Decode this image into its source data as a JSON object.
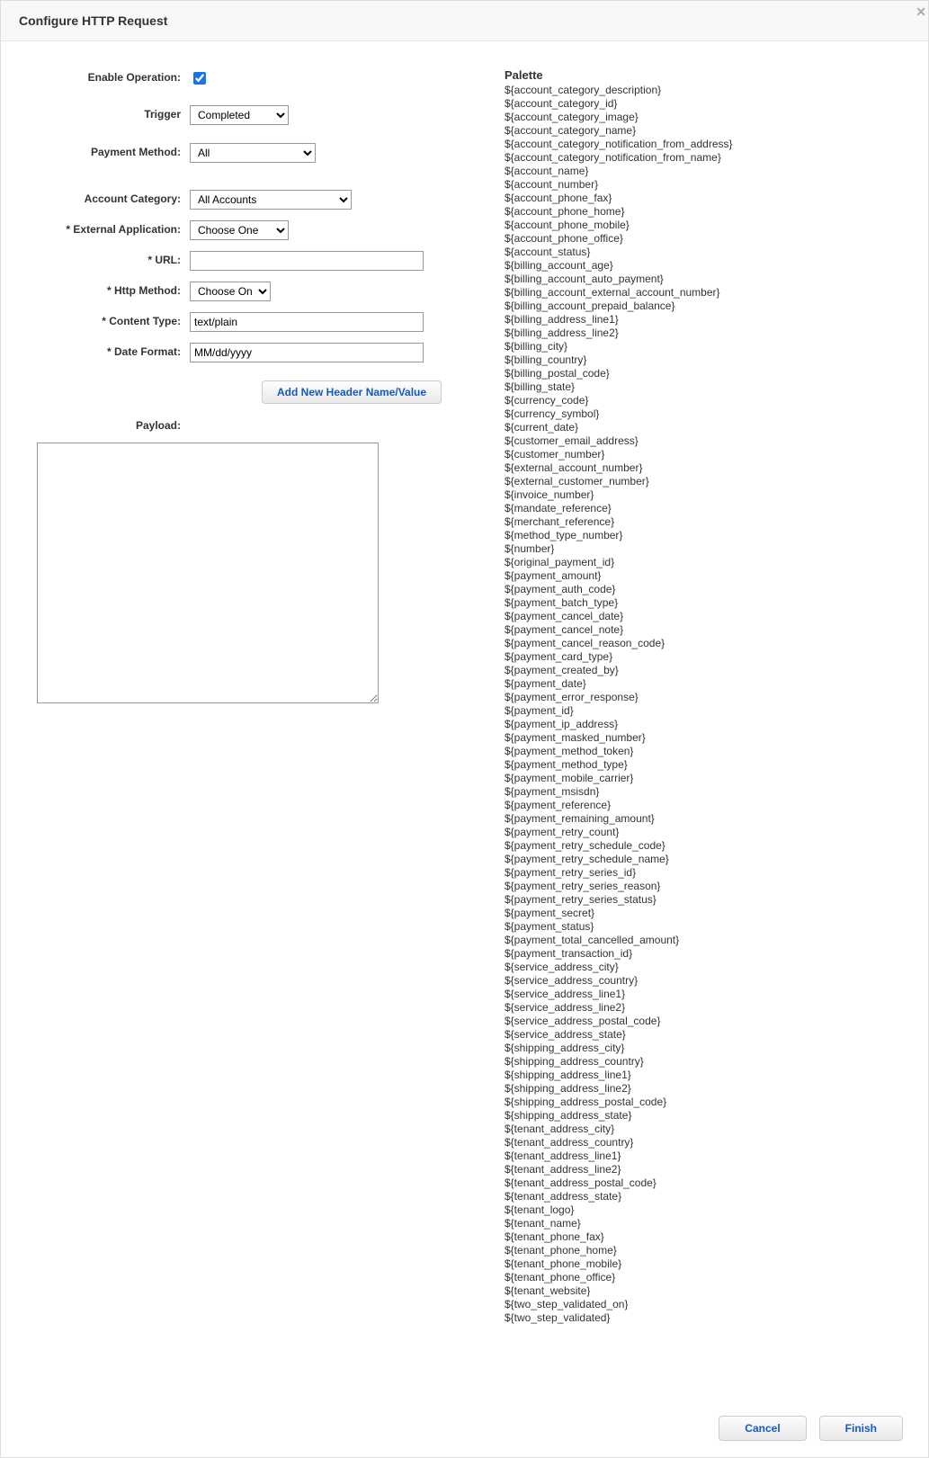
{
  "header": {
    "title": "Configure HTTP Request"
  },
  "form": {
    "enable_operation": {
      "label": "Enable Operation:",
      "checked": true
    },
    "trigger": {
      "label": "Trigger",
      "selected": "Completed"
    },
    "payment_method": {
      "label": "Payment Method:",
      "selected": "All"
    },
    "account_category": {
      "label": "Account Category:",
      "selected": "All Accounts"
    },
    "external_application": {
      "label": "* External Application:",
      "selected": "Choose One"
    },
    "url": {
      "label": "* URL:",
      "value": ""
    },
    "http_method": {
      "label": "* Http Method:",
      "selected": "Choose One"
    },
    "content_type": {
      "label": "* Content Type:",
      "value": "text/plain"
    },
    "date_format": {
      "label": "* Date Format:",
      "value": "MM/dd/yyyy"
    },
    "add_header_btn": "Add New Header Name/Value",
    "payload": {
      "label": "Payload:",
      "value": ""
    }
  },
  "palette": {
    "title": "Palette",
    "items": [
      "${account_category_description}",
      "${account_category_id}",
      "${account_category_image}",
      "${account_category_name}",
      "${account_category_notification_from_address}",
      "${account_category_notification_from_name}",
      "${account_name}",
      "${account_number}",
      "${account_phone_fax}",
      "${account_phone_home}",
      "${account_phone_mobile}",
      "${account_phone_office}",
      "${account_status}",
      "${billing_account_age}",
      "${billing_account_auto_payment}",
      "${billing_account_external_account_number}",
      "${billing_account_prepaid_balance}",
      "${billing_address_line1}",
      "${billing_address_line2}",
      "${billing_city}",
      "${billing_country}",
      "${billing_postal_code}",
      "${billing_state}",
      "${currency_code}",
      "${currency_symbol}",
      "${current_date}",
      "${customer_email_address}",
      "${customer_number}",
      "${external_account_number}",
      "${external_customer_number}",
      "${invoice_number}",
      "${mandate_reference}",
      "${merchant_reference}",
      "${method_type_number}",
      "${number}",
      "${original_payment_id}",
      "${payment_amount}",
      "${payment_auth_code}",
      "${payment_batch_type}",
      "${payment_cancel_date}",
      "${payment_cancel_note}",
      "${payment_cancel_reason_code}",
      "${payment_card_type}",
      "${payment_created_by}",
      "${payment_date}",
      "${payment_error_response}",
      "${payment_id}",
      "${payment_ip_address}",
      "${payment_masked_number}",
      "${payment_method_token}",
      "${payment_method_type}",
      "${payment_mobile_carrier}",
      "${payment_msisdn}",
      "${payment_reference}",
      "${payment_remaining_amount}",
      "${payment_retry_count}",
      "${payment_retry_schedule_code}",
      "${payment_retry_schedule_name}",
      "${payment_retry_series_id}",
      "${payment_retry_series_reason}",
      "${payment_retry_series_status}",
      "${payment_secret}",
      "${payment_status}",
      "${payment_total_cancelled_amount}",
      "${payment_transaction_id}",
      "${service_address_city}",
      "${service_address_country}",
      "${service_address_line1}",
      "${service_address_line2}",
      "${service_address_postal_code}",
      "${service_address_state}",
      "${shipping_address_city}",
      "${shipping_address_country}",
      "${shipping_address_line1}",
      "${shipping_address_line2}",
      "${shipping_address_postal_code}",
      "${shipping_address_state}",
      "${tenant_address_city}",
      "${tenant_address_country}",
      "${tenant_address_line1}",
      "${tenant_address_line2}",
      "${tenant_address_postal_code}",
      "${tenant_address_state}",
      "${tenant_logo}",
      "${tenant_name}",
      "${tenant_phone_fax}",
      "${tenant_phone_home}",
      "${tenant_phone_mobile}",
      "${tenant_phone_office}",
      "${tenant_website}",
      "${two_step_validated_on}",
      "${two_step_validated}"
    ]
  },
  "footer": {
    "cancel": "Cancel",
    "finish": "Finish"
  }
}
